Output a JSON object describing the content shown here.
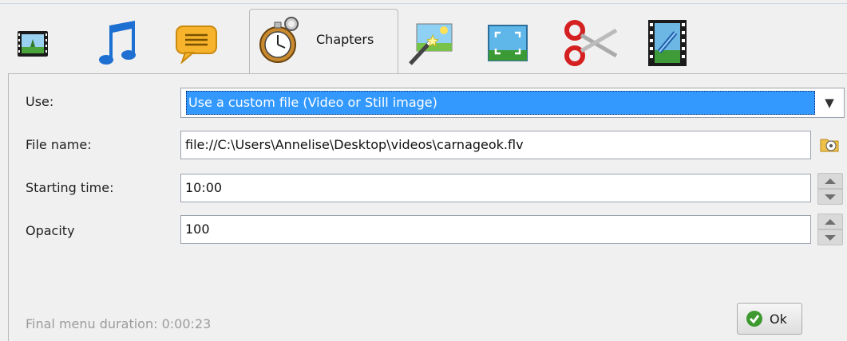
{
  "tabs": [
    {
      "icon": "video-icon"
    },
    {
      "icon": "music-note-icon"
    },
    {
      "icon": "speech-bubble-icon"
    },
    {
      "icon": "stopwatch-icon",
      "label": "Chapters",
      "active": true
    },
    {
      "icon": "magic-wand-image-icon"
    },
    {
      "icon": "fullscreen-image-icon"
    },
    {
      "icon": "scissors-icon"
    },
    {
      "icon": "film-link-icon"
    }
  ],
  "form": {
    "use_label": "Use:",
    "use_value": "Use a custom file (Video or Still image)",
    "file_name_label": "File name:",
    "file_name_value": "file://C:\\Users\\Annelise\\Desktop\\videos\\carnageok.flv",
    "starting_time_label": "Starting time:",
    "starting_time_value": "10:00",
    "opacity_label": "Opacity",
    "opacity_value": "100"
  },
  "footer": {
    "duration_text": "Final menu duration: 0:00:23",
    "ok_label": "Ok"
  }
}
